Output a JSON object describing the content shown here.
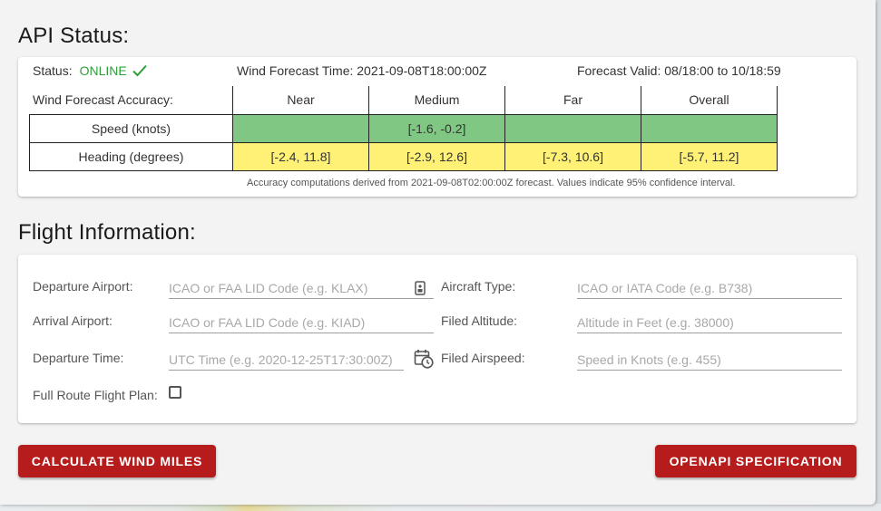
{
  "api_status": {
    "title": "API Status:",
    "status_label": "Status:",
    "status_value": "ONLINE",
    "status_color": "#2e9e3a",
    "wind_forecast_time": "Wind Forecast Time: 2021-09-08T18:00:00Z",
    "forecast_valid": "Forecast Valid: 08/18:00 to 10/18:59",
    "accuracy_label": "Wind Forecast Accuracy:",
    "columns": [
      "Near",
      "Medium",
      "Far",
      "Overall"
    ],
    "rows": [
      {
        "label": "Speed (knots)",
        "cells": [
          "",
          "[-1.6, -0.2]",
          "",
          ""
        ],
        "color": "#81c784"
      },
      {
        "label": "Heading (degrees)",
        "cells": [
          "[-2.4, 11.8]",
          "[-2.9, 12.6]",
          "[-7.3, 10.6]",
          "[-5.7, 11.2]"
        ],
        "color": "#fff176"
      }
    ],
    "note": "Accuracy computations derived from 2021-09-08T02:00:00Z forecast. Values indicate 95% confidence interval."
  },
  "flight_info": {
    "title": "Flight Information:",
    "departure_airport": {
      "label": "Departure Airport:",
      "placeholder": "ICAO or FAA LID Code (e.g. KLAX)",
      "value": ""
    },
    "arrival_airport": {
      "label": "Arrival Airport:",
      "placeholder": "ICAO or FAA LID Code (e.g. KIAD)",
      "value": ""
    },
    "departure_time": {
      "label": "Departure Time:",
      "placeholder": "UTC Time (e.g. 2020-12-25T17:30:00Z)",
      "value": ""
    },
    "full_route": {
      "label": "Full Route Flight Plan:",
      "checked": false
    },
    "aircraft_type": {
      "label": "Aircraft Type:",
      "placeholder": "ICAO or IATA Code (e.g. B738)",
      "value": ""
    },
    "filed_altitude": {
      "label": "Filed Altitude:",
      "placeholder": "Altitude in Feet (e.g. 38000)",
      "value": ""
    },
    "filed_airspeed": {
      "label": "Filed Airspeed:",
      "placeholder": "Speed in Knots (e.g. 455)",
      "value": ""
    }
  },
  "buttons": {
    "calculate": "CALCULATE WIND MILES",
    "openapi": "OPENAPI SPECIFICATION",
    "color": "#b71c1c"
  },
  "icons": {
    "status_check": "check-icon",
    "departure_airport_picker": "airport-list-icon",
    "departure_time_picker": "calendar-clock-icon"
  }
}
